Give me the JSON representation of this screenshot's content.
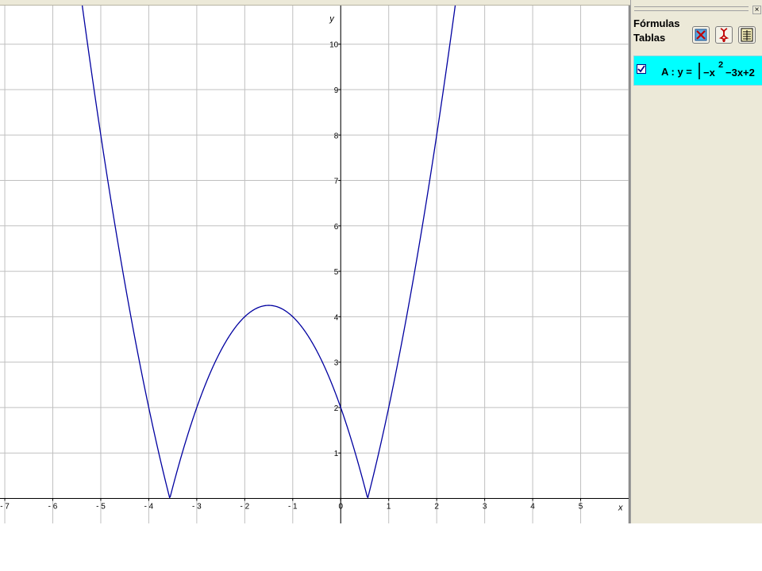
{
  "algebra_panel": {
    "heading_line1": "Fórmulas",
    "heading_line2": "Tablas",
    "close_glyph": "×",
    "buttons": [
      {
        "name": "auxiliary-objects-button",
        "icon": "red-x-icon"
      },
      {
        "name": "sort-objects-button",
        "icon": "dna-icon"
      },
      {
        "name": "table-view-button",
        "icon": "calculator-icon"
      }
    ],
    "row": {
      "label": "A : y =",
      "expression_minus": "−x",
      "expression_exponent": "2",
      "expression_rest": "−3x+2",
      "checked": true,
      "highlight_color": "#00ffff"
    }
  },
  "colors": {
    "panel_bg": "#ece9d8",
    "grid": "#c0c0c0",
    "axis": "#000000",
    "curve": "#0000a0"
  },
  "chart_data": {
    "type": "line",
    "title": "",
    "xlabel": "x",
    "ylabel": "y",
    "xlim": [
      -7.1,
      6.0
    ],
    "ylim": [
      -0.55,
      10.85
    ],
    "grid": true,
    "x_ticks": [
      "-7",
      "-6",
      "-5",
      "-4",
      "-3",
      "-2",
      "-1",
      "0",
      "1",
      "2",
      "3",
      "4",
      "5"
    ],
    "y_ticks": [
      "1",
      "2",
      "3",
      "4",
      "5",
      "6",
      "7",
      "8",
      "9",
      "10"
    ],
    "series": [
      {
        "name": "A",
        "function": "y = |-x^2 - 3x + 2|",
        "x": [
          -5.5,
          -5.25,
          -5,
          -4.75,
          -4.5,
          -4.25,
          -4,
          -3.75,
          -3.56,
          -3.5,
          -3.25,
          -3,
          -2.75,
          -2.5,
          -2.25,
          -2,
          -1.75,
          -1.5,
          -1.25,
          -1,
          -0.75,
          -0.5,
          -0.25,
          0,
          0.25,
          0.5,
          0.56,
          0.75,
          1,
          1.25,
          1.5,
          1.75,
          2,
          2.25,
          2.5
        ],
        "y": [
          11.75,
          9.81,
          8,
          6.31,
          4.75,
          3.31,
          2,
          0.81,
          0,
          0.25,
          1.19,
          2,
          2.69,
          3.25,
          3.69,
          4,
          4.19,
          4.25,
          4.19,
          4,
          3.69,
          3.25,
          2.69,
          2,
          1.19,
          0.25,
          0,
          0.81,
          2,
          3.31,
          4.75,
          6.31,
          8,
          9.81,
          11.75
        ]
      }
    ]
  }
}
